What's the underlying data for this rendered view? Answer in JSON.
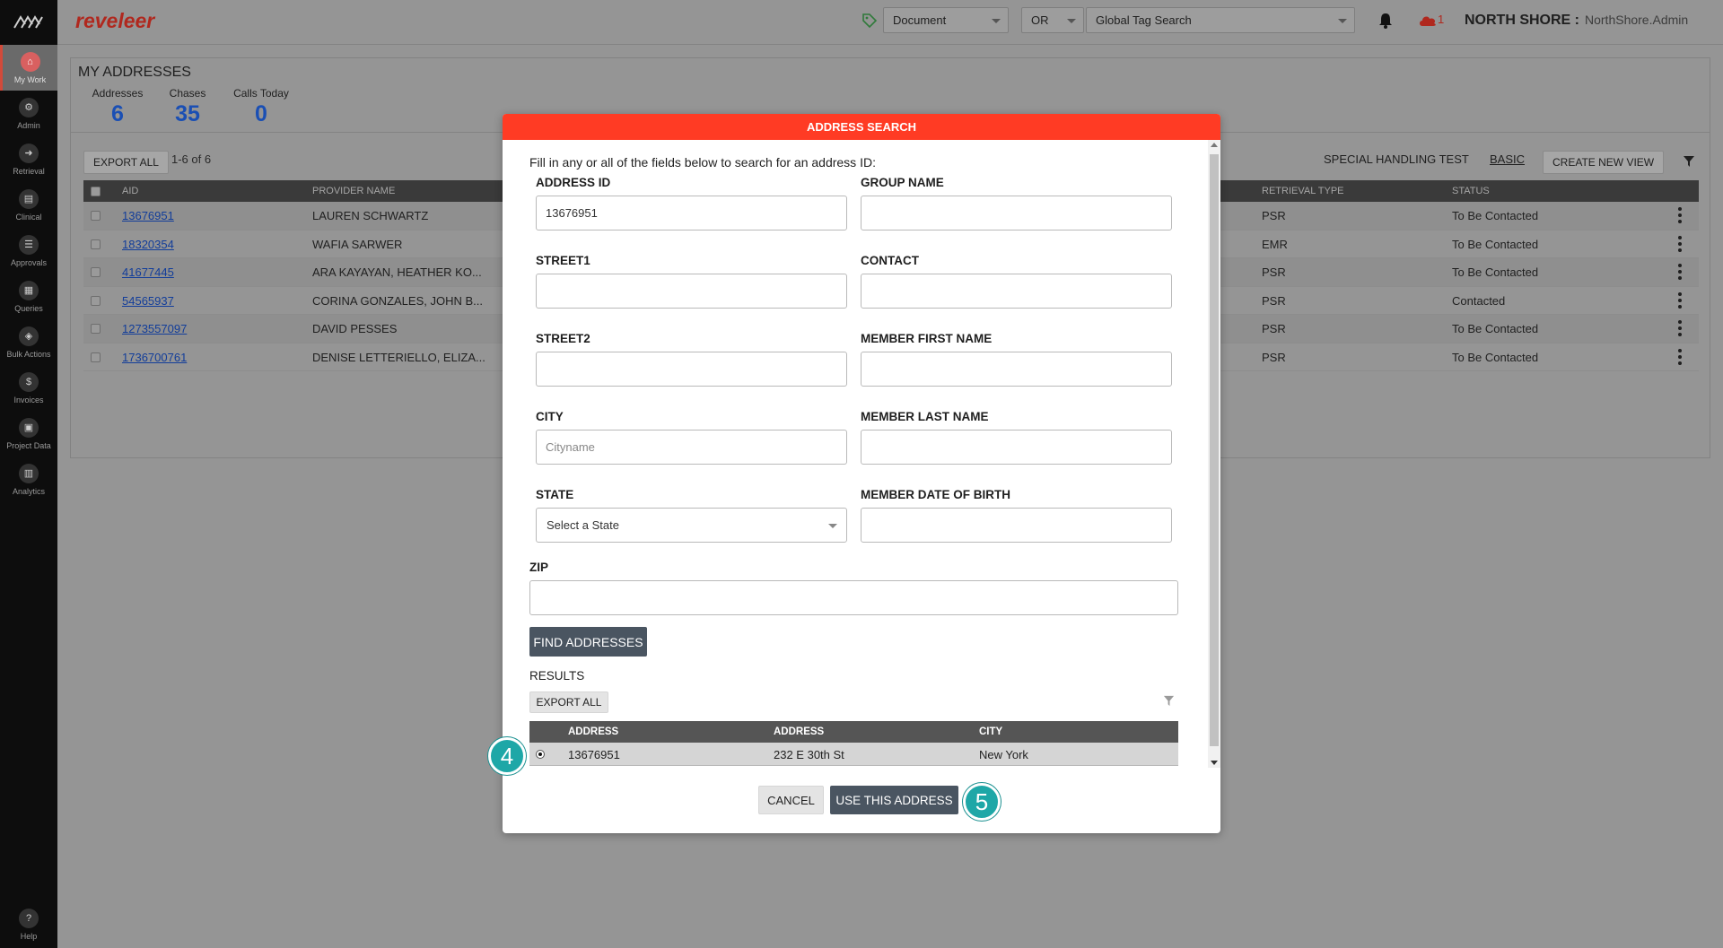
{
  "sidebar": {
    "items": [
      {
        "label": "My Work",
        "icon": "home-icon"
      },
      {
        "label": "Admin",
        "icon": "admin-icon"
      },
      {
        "label": "Retrieval",
        "icon": "retrieval-icon"
      },
      {
        "label": "Clinical",
        "icon": "clinical-icon"
      },
      {
        "label": "Approvals",
        "icon": "approvals-icon"
      },
      {
        "label": "Queries",
        "icon": "queries-icon"
      },
      {
        "label": "Bulk Actions",
        "icon": "bulk-actions-icon"
      },
      {
        "label": "Invoices",
        "icon": "invoices-icon"
      },
      {
        "label": "Project Data",
        "icon": "project-data-icon"
      },
      {
        "label": "Analytics",
        "icon": "analytics-icon"
      }
    ],
    "help_label": "Help"
  },
  "header": {
    "brand": "reveleer",
    "doc_select": "Document",
    "op_select": "OR",
    "tag_search": "Global Tag Search",
    "alert_count": "1",
    "org": "NORTH SHORE :",
    "user": "NorthShore.Admin"
  },
  "panel": {
    "title": "MY ADDRESSES",
    "stats": [
      {
        "label": "Addresses",
        "value": "6"
      },
      {
        "label": "Chases",
        "value": "35"
      },
      {
        "label": "Calls Today",
        "value": "0"
      }
    ],
    "export_label": "EXPORT ALL",
    "pager": "1-6  of  6",
    "view_name": "SPECIAL HANDLING TEST",
    "view_basic": "BASIC",
    "create_view": "CREATE NEW VIEW",
    "columns": {
      "aid": "AID",
      "provider": "PROVIDER NAME",
      "retrieval": "RETRIEVAL TYPE",
      "status": "STATUS"
    },
    "rows": [
      {
        "aid": "13676951",
        "provider": "LAUREN SCHWARTZ",
        "retrieval": "PSR",
        "status": "To Be Contacted"
      },
      {
        "aid": "18320354",
        "provider": "WAFIA SARWER",
        "retrieval": "EMR",
        "status": "To Be Contacted"
      },
      {
        "aid": "41677445",
        "provider": "ARA KAYAYAN, HEATHER KO...",
        "retrieval": "PSR",
        "status": "To Be Contacted"
      },
      {
        "aid": "54565937",
        "provider": "CORINA GONZALES, JOHN B...",
        "retrieval": "PSR",
        "status": "Contacted"
      },
      {
        "aid": "1273557097",
        "provider": "DAVID PESSES",
        "retrieval": "PSR",
        "status": "To Be Contacted"
      },
      {
        "aid": "1736700761",
        "provider": "DENISE LETTERIELLO, ELIZA...",
        "retrieval": "PSR",
        "status": "To Be Contacted"
      }
    ]
  },
  "modal": {
    "title": "ADDRESS SEARCH",
    "intro": "Fill in any or all of the fields below to search for an address ID:",
    "fields": {
      "address_id": {
        "label": "ADDRESS ID",
        "value": "13676951"
      },
      "group_name": {
        "label": "GROUP NAME",
        "value": ""
      },
      "street1": {
        "label": "STREET1",
        "value": ""
      },
      "contact": {
        "label": "CONTACT",
        "value": ""
      },
      "street2": {
        "label": "STREET2",
        "value": ""
      },
      "member_first": {
        "label": "MEMBER FIRST NAME",
        "value": ""
      },
      "city": {
        "label": "CITY",
        "placeholder": "Cityname"
      },
      "member_last": {
        "label": "MEMBER LAST NAME",
        "value": ""
      },
      "state": {
        "label": "STATE",
        "value": "Select a State"
      },
      "member_dob": {
        "label": "MEMBER DATE OF BIRTH",
        "value": ""
      },
      "zip": {
        "label": "ZIP",
        "value": ""
      }
    },
    "find_label": "FIND ADDRESSES",
    "results_label": "RESULTS",
    "export_label": "EXPORT ALL",
    "results_columns": {
      "c1": "ADDRESS",
      "c2": "ADDRESS",
      "c3": "CITY"
    },
    "results": [
      {
        "id": "13676951",
        "address": "232 E 30th St",
        "city": "New York"
      }
    ],
    "cancel_label": "CANCEL",
    "use_label": "USE THIS ADDRESS"
  },
  "steps": {
    "s4": "4",
    "s5": "5"
  },
  "colors": {
    "accent": "#ff3b24",
    "brand": "#b0281e",
    "link": "#123d9a",
    "step": "#1ea7a7",
    "button": "#4a5561"
  }
}
